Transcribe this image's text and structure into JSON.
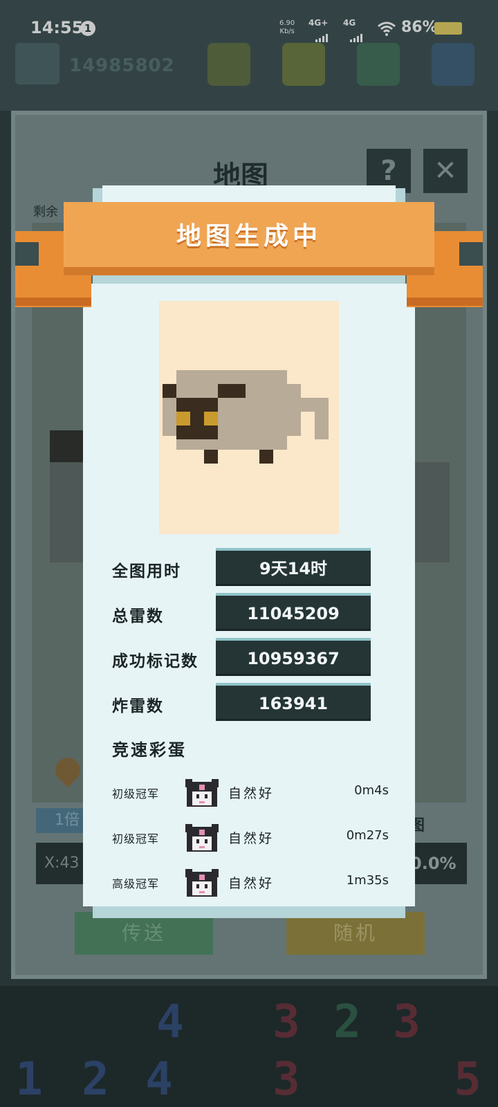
{
  "status_bar": {
    "time": "14:55",
    "notification_count": "1",
    "net_speed_value": "6.90",
    "net_speed_unit": "Kb/s",
    "network_1": "4G+",
    "network_2": "4G",
    "battery": "86%"
  },
  "background": {
    "user_id": "14985802",
    "window_title": "地图",
    "help_label": "?",
    "close_label": "✕",
    "remaining_label": "剩余",
    "speed_label": "1倍",
    "coord_label": "X:43",
    "map_label": "图",
    "progress_label": "0.0%",
    "teleport_button": "传送",
    "random_button": "随机",
    "grid_numbers": [
      "4",
      "3",
      "2",
      "3",
      "1",
      "2",
      "4",
      "3",
      "5"
    ]
  },
  "modal": {
    "title": "地图生成中",
    "stats": [
      {
        "label": "全图用时",
        "value": "9天14时"
      },
      {
        "label": "总雷数",
        "value": "11045209"
      },
      {
        "label": "成功标记数",
        "value": "10959367"
      },
      {
        "label": "炸雷数",
        "value": "163941"
      }
    ],
    "section_title": "竞速彩蛋",
    "rankings": [
      {
        "label": "初级冠军",
        "name": "自然好",
        "time": "0m4s"
      },
      {
        "label": "初级冠军",
        "name": "自然好",
        "time": "0m27s"
      },
      {
        "label": "高级冠军",
        "name": "自然好",
        "time": "1m35s"
      }
    ]
  },
  "colors": {
    "ribbon": "#f0a553",
    "card": "#e6f4f6",
    "stat_box": "#253536",
    "preview_bg": "#fbe7c9"
  }
}
